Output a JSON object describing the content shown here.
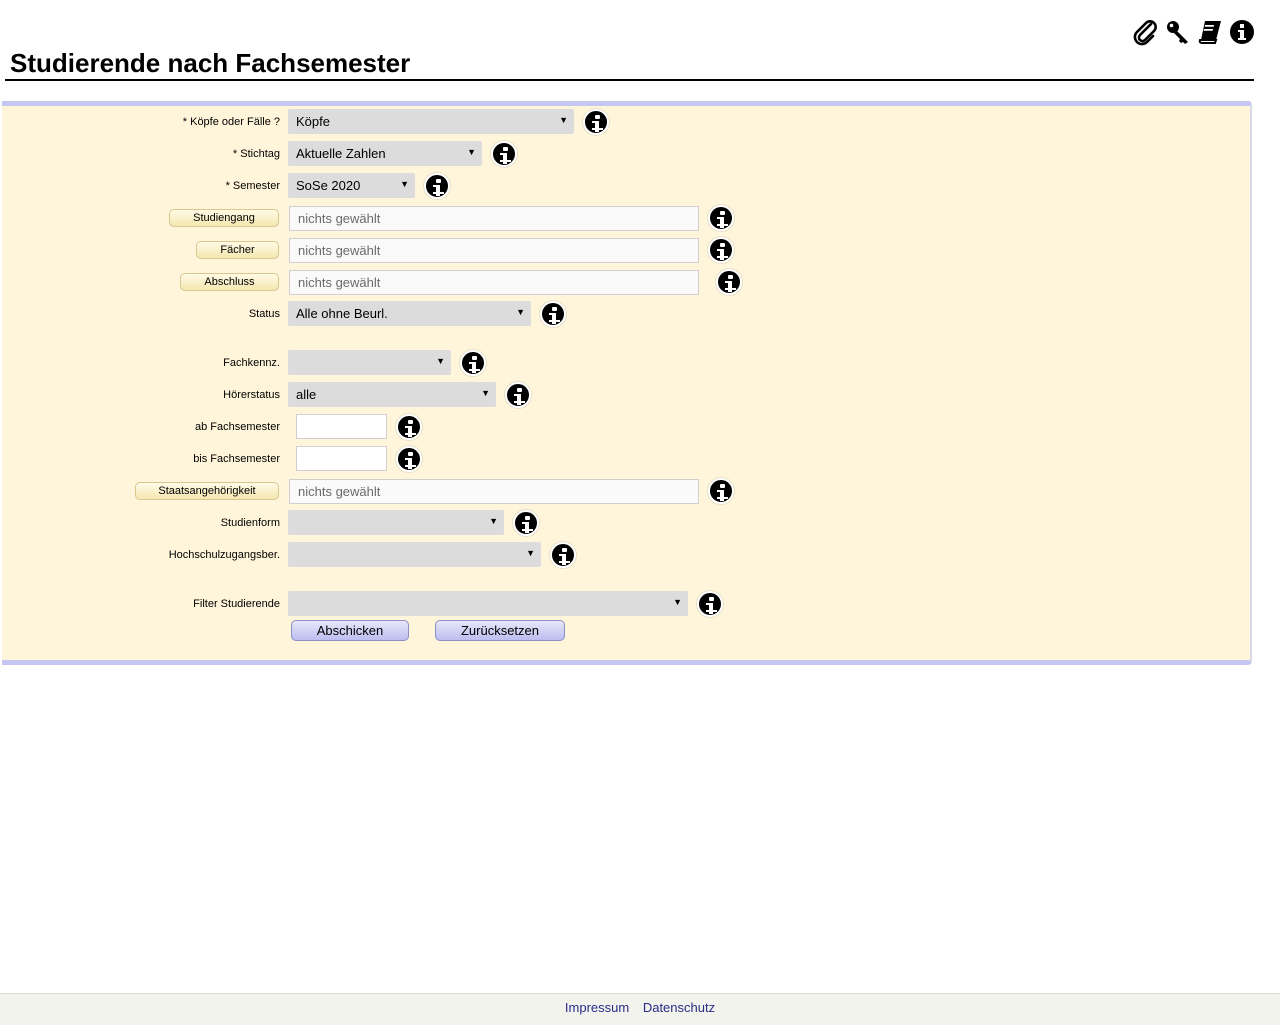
{
  "page": {
    "title": "Studierende nach Fachsemester"
  },
  "toolbar": {
    "icons": [
      "paperclip-icon",
      "key-icon",
      "book-icon",
      "info-icon"
    ]
  },
  "form": {
    "koepfe": {
      "label": "* Köpfe oder Fälle ?",
      "value": "Köpfe"
    },
    "stichtag": {
      "label": "* Stichtag",
      "value": "Aktuelle Zahlen"
    },
    "semester": {
      "label": "* Semester",
      "value": "SoSe 2020"
    },
    "studiengang": {
      "button": "Studiengang",
      "placeholder": "nichts gewählt"
    },
    "faecher": {
      "button": "Fächer",
      "placeholder": "nichts gewählt"
    },
    "abschluss": {
      "button": "Abschluss",
      "placeholder": "nichts gewählt"
    },
    "status": {
      "label": "Status",
      "value": "Alle ohne Beurl."
    },
    "fachkennz": {
      "label": "Fachkennz.",
      "value": ""
    },
    "hoererstatus": {
      "label": "Hörerstatus",
      "value": "alle"
    },
    "ab_fachsemester": {
      "label": "ab Fachsemester",
      "value": ""
    },
    "bis_fachsemester": {
      "label": "bis Fachsemester",
      "value": ""
    },
    "staatsangehoerigkeit": {
      "button": "Staatsangehörigkeit",
      "placeholder": "nichts gewählt"
    },
    "studienform": {
      "label": "Studienform",
      "value": ""
    },
    "hochschulzugang": {
      "label": "Hochschulzugangsber.",
      "value": ""
    },
    "filter": {
      "label": "Filter Studierende",
      "value": ""
    },
    "submit_label": "Abschicken",
    "reset_label": "Zurücksetzen"
  },
  "footer": {
    "impressum": "Impressum",
    "datenschutz": "Datenschutz"
  }
}
